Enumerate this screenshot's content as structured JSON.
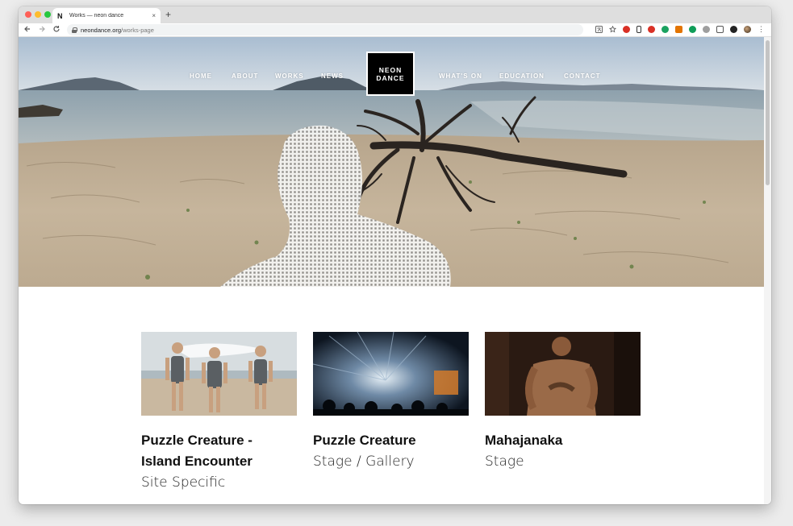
{
  "browser": {
    "tab_title": "Works — neon dance",
    "tab_favicon": "N",
    "url_domain": "neondance.org",
    "url_path": "/works-page",
    "new_tab_glyph": "+",
    "close_glyph": "×"
  },
  "site": {
    "logo_line1": "NEON",
    "logo_line2": "DANCE",
    "nav": {
      "home": "HOME",
      "about": "ABOUT",
      "works": "WORKS",
      "news": "NEWS",
      "whats_on": "WHAT'S ON",
      "education": "EDUCATION",
      "contact": "CONTACT"
    }
  },
  "works": [
    {
      "title_line1": "Puzzle Creature -",
      "title_line2": "Island Encounter",
      "category": "Site Specific"
    },
    {
      "title_line1": "Puzzle Creature",
      "title_line2": "",
      "category": "Stage / Gallery"
    },
    {
      "title_line1": "Mahajanaka",
      "title_line2": "",
      "category": "Stage"
    }
  ],
  "colors": {
    "extensions": [
      "#d93025",
      "#333333",
      "#d93025",
      "#1aa260",
      "#e37400",
      "#0f9d58",
      "#1a73e8",
      "#777777",
      "#555555",
      "#222222"
    ]
  },
  "icons": {
    "back": "back-arrow-icon",
    "forward": "forward-arrow-icon",
    "reload": "reload-icon",
    "lock": "lock-icon",
    "star": "bookmark-star-icon",
    "menu": "kebab-menu-icon"
  }
}
